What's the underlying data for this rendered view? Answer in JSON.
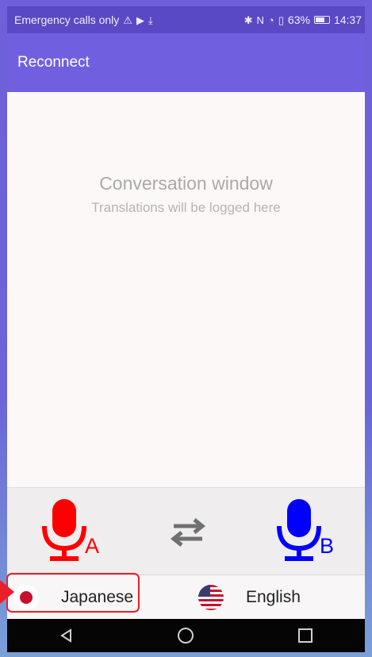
{
  "status_bar": {
    "carrier": "Emergency calls only",
    "battery": "63%",
    "time": "14:37"
  },
  "app_bar": {
    "title": "Reconnect"
  },
  "conversation": {
    "title": "Conversation window",
    "subtitle": "Translations will be logged here"
  },
  "controls": {
    "mic_a": {
      "letter": "A",
      "color": "#ff0000"
    },
    "mic_b": {
      "letter": "B",
      "color": "#0000ff"
    },
    "swap_icon": "swap-arrows-icon"
  },
  "languages": {
    "left": {
      "label": "Japanese",
      "flag": "japan-flag-icon"
    },
    "right": {
      "label": "English",
      "flag": "us-flag-icon"
    }
  },
  "navigation": {
    "buttons": [
      "back",
      "home",
      "recents"
    ]
  },
  "colors": {
    "status_bar": "#5a49c4",
    "app_bar": "#7060e0",
    "highlight": "#e8202a"
  }
}
